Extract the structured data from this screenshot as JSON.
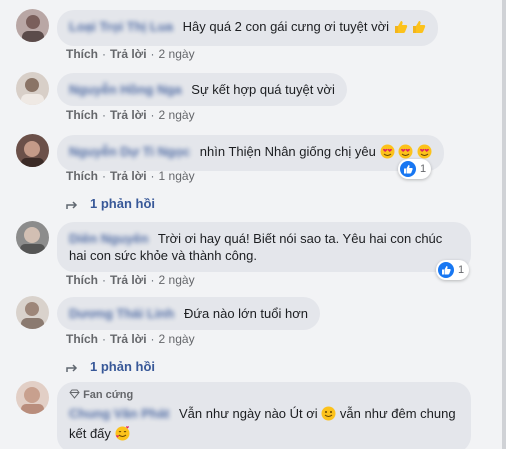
{
  "comments": [
    {
      "author": "Loại Trọi Thị Lua",
      "text": "Hây quá 2 con gái cưng ơi tuyệt vời",
      "like_label": "Thích",
      "reply_label": "Trả lời",
      "time": "2 ngày"
    },
    {
      "author": "Nguyễn Hồng Nga",
      "text": "Sự kết hợp quá tuyệt vời",
      "like_label": "Thích",
      "reply_label": "Trả lời",
      "time": "2 ngày"
    },
    {
      "author": "Nguyễn Dự Ti Ngọc",
      "text": "nhìn Thiện Nhân giống chị yêu",
      "like_label": "Thích",
      "reply_label": "Trả lời",
      "time": "1 ngày",
      "reaction_count": "1",
      "replies": "1 phản hồi"
    },
    {
      "author": "Diên Nguyên",
      "text": "Trời ơi hay quá! Biết nói sao ta. Yêu hai con chúc hai con sức khỏe và thành công.",
      "like_label": "Thích",
      "reply_label": "Trả lời",
      "time": "2 ngày",
      "reaction_count": "1"
    },
    {
      "author": "Dương Thái Linh",
      "text": "Đứa nào lớn tuổi hơn",
      "like_label": "Thích",
      "reply_label": "Trả lời",
      "time": "2 ngày",
      "replies": "1 phản hồi"
    },
    {
      "badge": "Fan cứng",
      "author": "Chung Văn Phát",
      "text_a": "Vẫn như ngày nào Út ơi",
      "text_b": "vẫn như đêm chung kết đấy"
    }
  ],
  "colors": {
    "bubble": "#e4e6eb",
    "link": "#385898",
    "like_blue": "#1877f2",
    "background": "#f2f3f5"
  },
  "icons": [
    "thumbs-up-emoji",
    "heart-eyes-emoji",
    "like-reaction-icon",
    "reply-arrow-icon",
    "diamond-icon",
    "smile-emoji",
    "smiling-face-with-hearts-emoji"
  ]
}
